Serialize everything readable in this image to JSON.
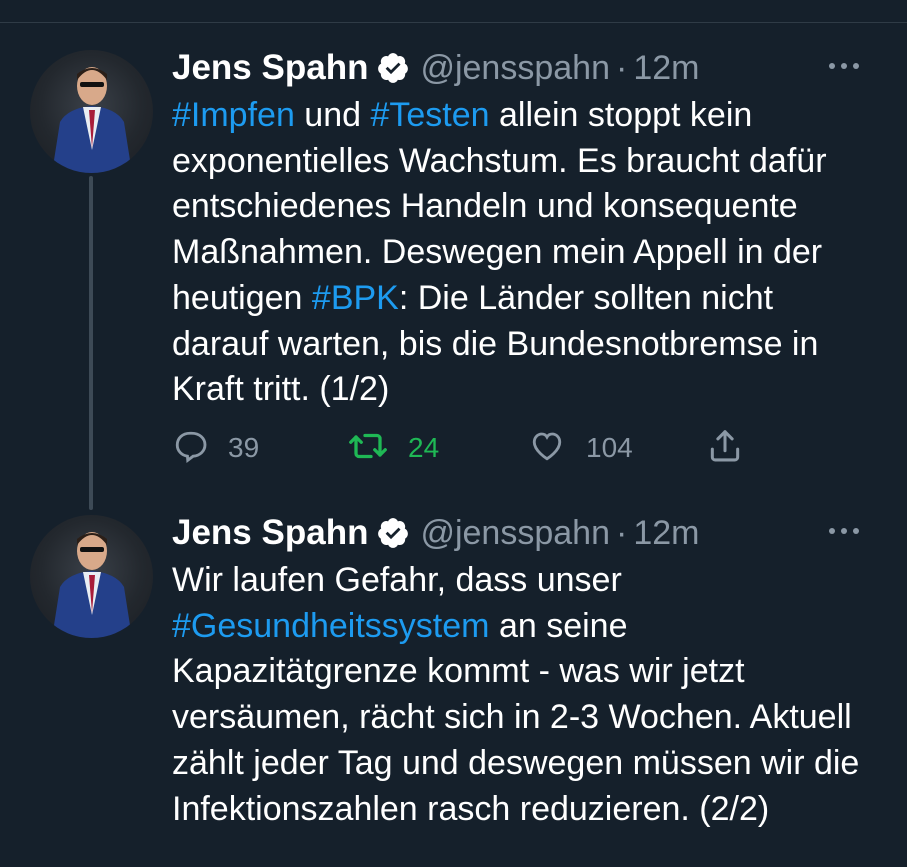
{
  "tweets": [
    {
      "name": "Jens Spahn",
      "handle": "@jensspahn",
      "separator": "·",
      "time": "12m",
      "segments": [
        {
          "text": "#Impfen",
          "tag": true
        },
        {
          "text": " und ",
          "tag": false
        },
        {
          "text": "#Testen",
          "tag": true
        },
        {
          "text": " allein stoppt kein exponentielles Wachstum. Es braucht dafür entschiedenes Handeln und konsequente Maßnahmen. Deswegen mein Appell in der heutigen ",
          "tag": false
        },
        {
          "text": "#BPK",
          "tag": true
        },
        {
          "text": ": Die Länder sollten nicht darauf warten, bis die Bundesnotbremse in Kraft tritt. (1/2)",
          "tag": false
        }
      ],
      "replies": "39",
      "retweets": "24",
      "likes": "104"
    },
    {
      "name": "Jens Spahn",
      "handle": "@jensspahn",
      "separator": "·",
      "time": "12m",
      "segments": [
        {
          "text": "Wir laufen Gefahr, dass unser ",
          "tag": false
        },
        {
          "text": "#Gesundheitssystem",
          "tag": true
        },
        {
          "text": " an seine Kapazitätgrenze kommt - was wir jetzt versäumen, rächt sich in 2-3 Wochen. Aktuell zählt jeder Tag und deswegen müssen wir die Infektionszahlen rasch reduzieren. (2/2)",
          "tag": false
        }
      ]
    }
  ],
  "colors": {
    "background": "#15202b",
    "hashtag": "#1d9bf0",
    "secondary_text": "#8b98a5",
    "retweeted": "#1fb855",
    "verified": "#ffffff"
  },
  "icons": [
    "avatar",
    "verified-badge-icon",
    "more-icon",
    "reply-icon",
    "retweet-icon",
    "like-icon",
    "share-icon"
  ]
}
